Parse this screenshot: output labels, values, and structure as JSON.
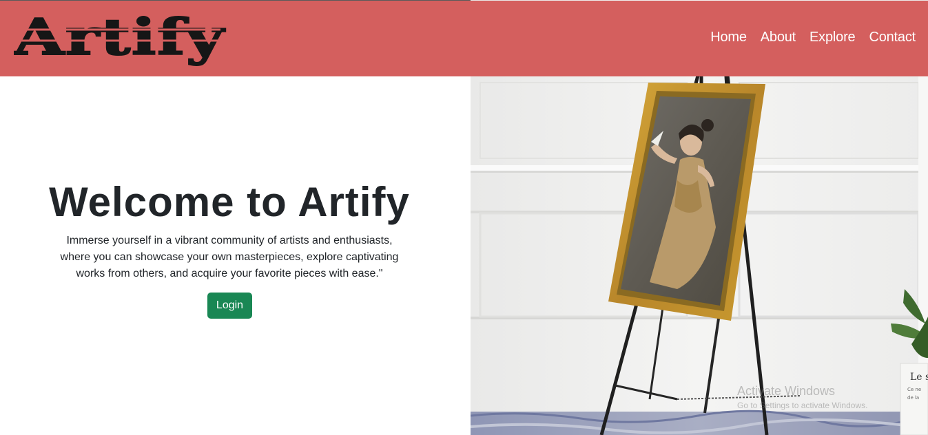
{
  "brand": {
    "logo_text": "Artify",
    "color": "#d45f5e"
  },
  "nav": {
    "items": [
      {
        "label": "Home"
      },
      {
        "label": "About"
      },
      {
        "label": "Explore"
      },
      {
        "label": "Contact"
      }
    ]
  },
  "hero": {
    "title": "Welcome to Artify",
    "description": "Immerse yourself in a vibrant community of artists and enthusiasts, where you can showcase your own masterpieces, explore captivating works from others, and acquire your favorite pieces with ease.\"",
    "login_label": "Login",
    "button_color": "#198754"
  },
  "watermark": {
    "line1": "Activate Windows",
    "line2": "Go to Settings to activate Windows."
  }
}
